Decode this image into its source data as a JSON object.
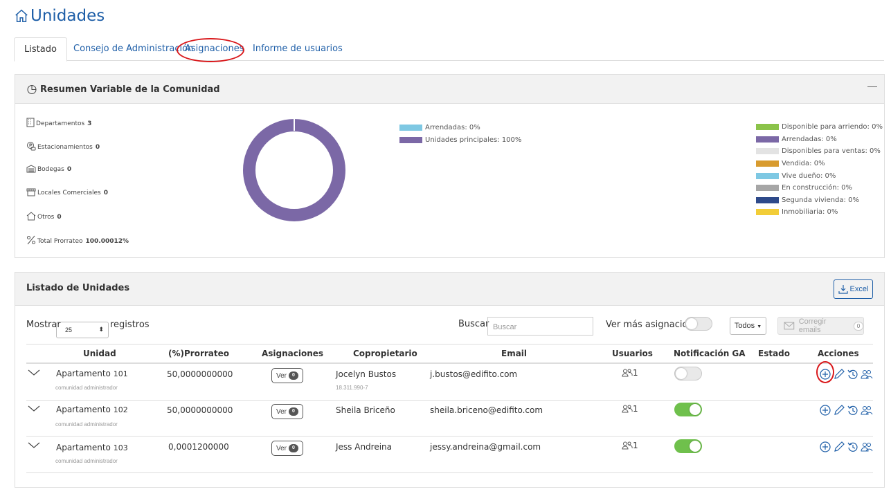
{
  "page": {
    "title": "Unidades"
  },
  "tabs": [
    {
      "label": "Listado",
      "active": true
    },
    {
      "label": "Consejo de Administración",
      "active": false
    },
    {
      "label": "Asignaciones",
      "active": false,
      "highlighted": true
    },
    {
      "label": "Informe de usuarios",
      "active": false
    }
  ],
  "summary": {
    "title": "Resumen Variable de la Comunidad",
    "collapse_symbol": "—",
    "stats": [
      {
        "label": "Departamentos",
        "value": "3",
        "icon": "building-icon"
      },
      {
        "label": "Estacionamientos",
        "value": "0",
        "icon": "parking-icon"
      },
      {
        "label": "Bodegas",
        "value": "0",
        "icon": "warehouse-icon"
      },
      {
        "label": "Locales Comerciales",
        "value": "0",
        "icon": "store-icon"
      },
      {
        "label": "Otros",
        "value": "0",
        "icon": "home-icon"
      },
      {
        "label": "Total Prorrateo",
        "value": "100.00012%",
        "icon": "percent-icon"
      }
    ],
    "donut_legend": [
      {
        "label": "Arrendadas: 0%",
        "color": "#7ec8e3"
      },
      {
        "label": "Unidades principales: 100%",
        "color": "#7b68a6"
      }
    ],
    "status_legend": [
      {
        "label": "Disponible para arriendo: 0%",
        "color": "#8bc34a"
      },
      {
        "label": "Arrendadas: 0%",
        "color": "#7b68a6"
      },
      {
        "label": "Disponibles para ventas: 0%",
        "color": "#e3e3e3"
      },
      {
        "label": "Vendida: 0%",
        "color": "#d89b2f"
      },
      {
        "label": "Vive dueño: 0%",
        "color": "#7ec8e3"
      },
      {
        "label": "En construcción: 0%",
        "color": "#a6a6a6"
      },
      {
        "label": "Segunda vivienda: 0%",
        "color": "#2e4a8a"
      },
      {
        "label": "Inmobiliaria: 0%",
        "color": "#f2cd38"
      }
    ],
    "donut_color": "#7b68a6"
  },
  "listado": {
    "title": "Listado de Unidades",
    "excel_label": "Excel",
    "mostrar_label": "Mostrar",
    "page_size": "25",
    "registros_label": "registros",
    "buscar_label": "Buscar",
    "buscar_placeholder": "Buscar",
    "ver_mas_label": "Ver más asignaciones",
    "todos_label": "Todos",
    "corregir_label": "Corregir emails",
    "corregir_count": "0",
    "columns": [
      "Unidad",
      "(%)Prorrateo",
      "Asignaciones",
      "Copropietario",
      "Email",
      "Usuarios",
      "Notificación GA",
      "Estado",
      "Acciones"
    ],
    "ver_label": "Ver",
    "rows": [
      {
        "unidad": "Apartamento",
        "numero": "101",
        "sub": "comunidad administrador",
        "prorrateo": "50,0000000000",
        "asignaciones": "0",
        "copropietario": "Jocelyn Bustos",
        "rut": "18.311.990-7",
        "email": "j.bustos@edifito.com",
        "usuarios": "1",
        "notificacion": false,
        "estado": ""
      },
      {
        "unidad": "Apartamento",
        "numero": "102",
        "sub": "comunidad administrador",
        "prorrateo": "50,0000000000",
        "asignaciones": "0",
        "copropietario": "Sheila Briceño",
        "rut": "",
        "email": "sheila.briceno@edifito.com",
        "usuarios": "1",
        "notificacion": true,
        "estado": ""
      },
      {
        "unidad": "Apartamento",
        "numero": "103",
        "sub": "comunidad administrador",
        "prorrateo": "0,0001200000",
        "asignaciones": "0",
        "copropietario": "Jess Andreina",
        "rut": "",
        "email": "jessy.andreina@gmail.com",
        "usuarios": "1",
        "notificacion": true,
        "estado": ""
      }
    ]
  },
  "colors": {
    "link": "#1f5fa8",
    "highlight": "#d9181b",
    "toggle_on": "#6fc04c"
  }
}
